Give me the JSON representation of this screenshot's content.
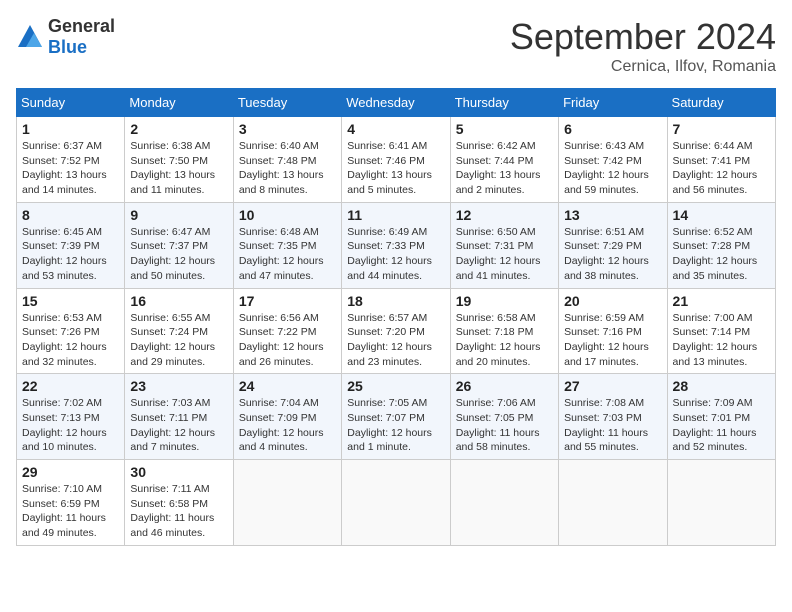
{
  "logo": {
    "general": "General",
    "blue": "Blue",
    "tagline": "General Blue"
  },
  "title": "September 2024",
  "subtitle": "Cernica, Ilfov, Romania",
  "days_of_week": [
    "Sunday",
    "Monday",
    "Tuesday",
    "Wednesday",
    "Thursday",
    "Friday",
    "Saturday"
  ],
  "weeks": [
    [
      {
        "day": 1,
        "sunrise": "6:37 AM",
        "sunset": "7:52 PM",
        "daylight": "13 hours and 14 minutes."
      },
      {
        "day": 2,
        "sunrise": "6:38 AM",
        "sunset": "7:50 PM",
        "daylight": "13 hours and 11 minutes."
      },
      {
        "day": 3,
        "sunrise": "6:40 AM",
        "sunset": "7:48 PM",
        "daylight": "13 hours and 8 minutes."
      },
      {
        "day": 4,
        "sunrise": "6:41 AM",
        "sunset": "7:46 PM",
        "daylight": "13 hours and 5 minutes."
      },
      {
        "day": 5,
        "sunrise": "6:42 AM",
        "sunset": "7:44 PM",
        "daylight": "13 hours and 2 minutes."
      },
      {
        "day": 6,
        "sunrise": "6:43 AM",
        "sunset": "7:42 PM",
        "daylight": "12 hours and 59 minutes."
      },
      {
        "day": 7,
        "sunrise": "6:44 AM",
        "sunset": "7:41 PM",
        "daylight": "12 hours and 56 minutes."
      }
    ],
    [
      {
        "day": 8,
        "sunrise": "6:45 AM",
        "sunset": "7:39 PM",
        "daylight": "12 hours and 53 minutes."
      },
      {
        "day": 9,
        "sunrise": "6:47 AM",
        "sunset": "7:37 PM",
        "daylight": "12 hours and 50 minutes."
      },
      {
        "day": 10,
        "sunrise": "6:48 AM",
        "sunset": "7:35 PM",
        "daylight": "12 hours and 47 minutes."
      },
      {
        "day": 11,
        "sunrise": "6:49 AM",
        "sunset": "7:33 PM",
        "daylight": "12 hours and 44 minutes."
      },
      {
        "day": 12,
        "sunrise": "6:50 AM",
        "sunset": "7:31 PM",
        "daylight": "12 hours and 41 minutes."
      },
      {
        "day": 13,
        "sunrise": "6:51 AM",
        "sunset": "7:29 PM",
        "daylight": "12 hours and 38 minutes."
      },
      {
        "day": 14,
        "sunrise": "6:52 AM",
        "sunset": "7:28 PM",
        "daylight": "12 hours and 35 minutes."
      }
    ],
    [
      {
        "day": 15,
        "sunrise": "6:53 AM",
        "sunset": "7:26 PM",
        "daylight": "12 hours and 32 minutes."
      },
      {
        "day": 16,
        "sunrise": "6:55 AM",
        "sunset": "7:24 PM",
        "daylight": "12 hours and 29 minutes."
      },
      {
        "day": 17,
        "sunrise": "6:56 AM",
        "sunset": "7:22 PM",
        "daylight": "12 hours and 26 minutes."
      },
      {
        "day": 18,
        "sunrise": "6:57 AM",
        "sunset": "7:20 PM",
        "daylight": "12 hours and 23 minutes."
      },
      {
        "day": 19,
        "sunrise": "6:58 AM",
        "sunset": "7:18 PM",
        "daylight": "12 hours and 20 minutes."
      },
      {
        "day": 20,
        "sunrise": "6:59 AM",
        "sunset": "7:16 PM",
        "daylight": "12 hours and 17 minutes."
      },
      {
        "day": 21,
        "sunrise": "7:00 AM",
        "sunset": "7:14 PM",
        "daylight": "12 hours and 13 minutes."
      }
    ],
    [
      {
        "day": 22,
        "sunrise": "7:02 AM",
        "sunset": "7:13 PM",
        "daylight": "12 hours and 10 minutes."
      },
      {
        "day": 23,
        "sunrise": "7:03 AM",
        "sunset": "7:11 PM",
        "daylight": "12 hours and 7 minutes."
      },
      {
        "day": 24,
        "sunrise": "7:04 AM",
        "sunset": "7:09 PM",
        "daylight": "12 hours and 4 minutes."
      },
      {
        "day": 25,
        "sunrise": "7:05 AM",
        "sunset": "7:07 PM",
        "daylight": "12 hours and 1 minute."
      },
      {
        "day": 26,
        "sunrise": "7:06 AM",
        "sunset": "7:05 PM",
        "daylight": "11 hours and 58 minutes."
      },
      {
        "day": 27,
        "sunrise": "7:08 AM",
        "sunset": "7:03 PM",
        "daylight": "11 hours and 55 minutes."
      },
      {
        "day": 28,
        "sunrise": "7:09 AM",
        "sunset": "7:01 PM",
        "daylight": "11 hours and 52 minutes."
      }
    ],
    [
      {
        "day": 29,
        "sunrise": "7:10 AM",
        "sunset": "6:59 PM",
        "daylight": "11 hours and 49 minutes."
      },
      {
        "day": 30,
        "sunrise": "7:11 AM",
        "sunset": "6:58 PM",
        "daylight": "11 hours and 46 minutes."
      },
      null,
      null,
      null,
      null,
      null
    ]
  ]
}
